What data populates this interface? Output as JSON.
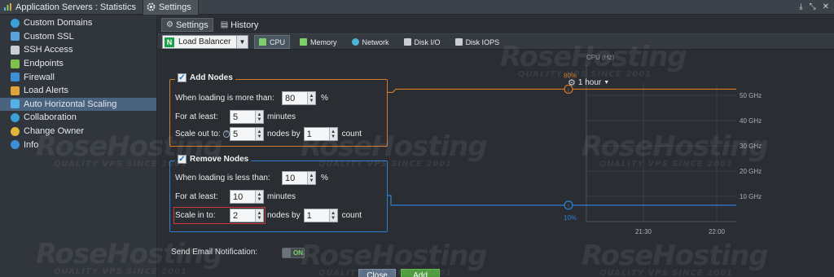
{
  "titlebar": {
    "tabs": [
      {
        "label": "Application Servers : Statistics",
        "active": false
      },
      {
        "label": "Settings",
        "active": true
      }
    ]
  },
  "sidebar": {
    "items": [
      {
        "label": "Custom Domains",
        "icon": "domains-icon",
        "color": "#3aa0d8",
        "active": false
      },
      {
        "label": "Custom SSL",
        "icon": "ssl-icon",
        "color": "#5aa0dc",
        "active": false
      },
      {
        "label": "SSH Access",
        "icon": "ssh-icon",
        "color": "#c9cfd5",
        "active": false
      },
      {
        "label": "Endpoints",
        "icon": "endpoints-icon",
        "color": "#7fc24a",
        "active": false
      },
      {
        "label": "Firewall",
        "icon": "firewall-icon",
        "color": "#3f8fd6",
        "active": false
      },
      {
        "label": "Load Alerts",
        "icon": "load-alerts-icon",
        "color": "#e0a33a",
        "active": false
      },
      {
        "label": "Auto Horizontal Scaling",
        "icon": "scaling-icon",
        "color": "#56b0e8",
        "active": true
      },
      {
        "label": "Collaboration",
        "icon": "collaboration-icon",
        "color": "#3aa0d8",
        "active": false
      },
      {
        "label": "Change Owner",
        "icon": "change-owner-icon",
        "color": "#e0b53a",
        "active": false
      },
      {
        "label": "Info",
        "icon": "info-icon",
        "color": "#3a8fd8",
        "active": false
      }
    ]
  },
  "main": {
    "tabs": [
      {
        "label": "Settings",
        "icon": "gear-icon",
        "active": true
      },
      {
        "label": "History",
        "icon": "history-icon",
        "active": false
      }
    ],
    "node_select": {
      "letter": "N",
      "value": "Load Balancer"
    },
    "metric_tabs": [
      {
        "label": "CPU",
        "icon": "cpu-icon",
        "active": true,
        "color": "#7fcf6a"
      },
      {
        "label": "Memory",
        "icon": "memory-icon",
        "active": false,
        "color": "#7fcf6a"
      },
      {
        "label": "Network",
        "icon": "network-icon",
        "active": false,
        "color": "#4fb3d8"
      },
      {
        "label": "Disk I/O",
        "icon": "disk-io-icon",
        "active": false,
        "color": "#c9cfd5"
      },
      {
        "label": "Disk IOPS",
        "icon": "disk-iops-icon",
        "active": false,
        "color": "#c9cfd5"
      }
    ]
  },
  "add_nodes": {
    "title": "Add Nodes",
    "checked": true,
    "loading_label": "When loading is more than:",
    "loading_value": "80",
    "loading_unit": "%",
    "atleast_label": "For at least:",
    "atleast_value": "5",
    "atleast_unit": "minutes",
    "scale_label": "Scale out to:",
    "scale_value": "5",
    "nodes_by_label": "nodes by",
    "count_value": "1",
    "count_label": "count"
  },
  "remove_nodes": {
    "title": "Remove Nodes",
    "checked": true,
    "loading_label": "When loading is less than:",
    "loading_value": "10",
    "loading_unit": "%",
    "atleast_label": "For at least:",
    "atleast_value": "10",
    "atleast_unit": "minutes",
    "scale_label": "Scale in to:",
    "scale_value": "2",
    "nodes_by_label": "nodes by",
    "count_value": "1",
    "count_label": "count"
  },
  "email": {
    "label": "Send Email Notification:",
    "toggle": "ON"
  },
  "buttons": {
    "close": "Close",
    "add": "Add"
  },
  "range": {
    "label": "1 hour"
  },
  "colors": {
    "add": "#d07a2a",
    "remove": "#2f7fcf",
    "accent": "#4a637f"
  },
  "watermark": {
    "brand": "RoseHosting",
    "tagline": "QUALITY VPS SINCE 2001"
  },
  "chart_data": {
    "type": "line",
    "title": "CPU (Hz)",
    "y_ticks": [
      "50 GHz",
      "40 GHz",
      "30 GHz",
      "20 GHz",
      "10 GHz"
    ],
    "y_tick_values": [
      50,
      40,
      30,
      20,
      10
    ],
    "x_ticks": [
      "21:30",
      "22:00"
    ],
    "thresholds": [
      {
        "label": "80%",
        "value": 52.5,
        "color": "#d07a2a"
      },
      {
        "label": "10%",
        "value": 6.5,
        "color": "#2f7fcf"
      }
    ],
    "ylim": [
      0,
      62
    ]
  }
}
